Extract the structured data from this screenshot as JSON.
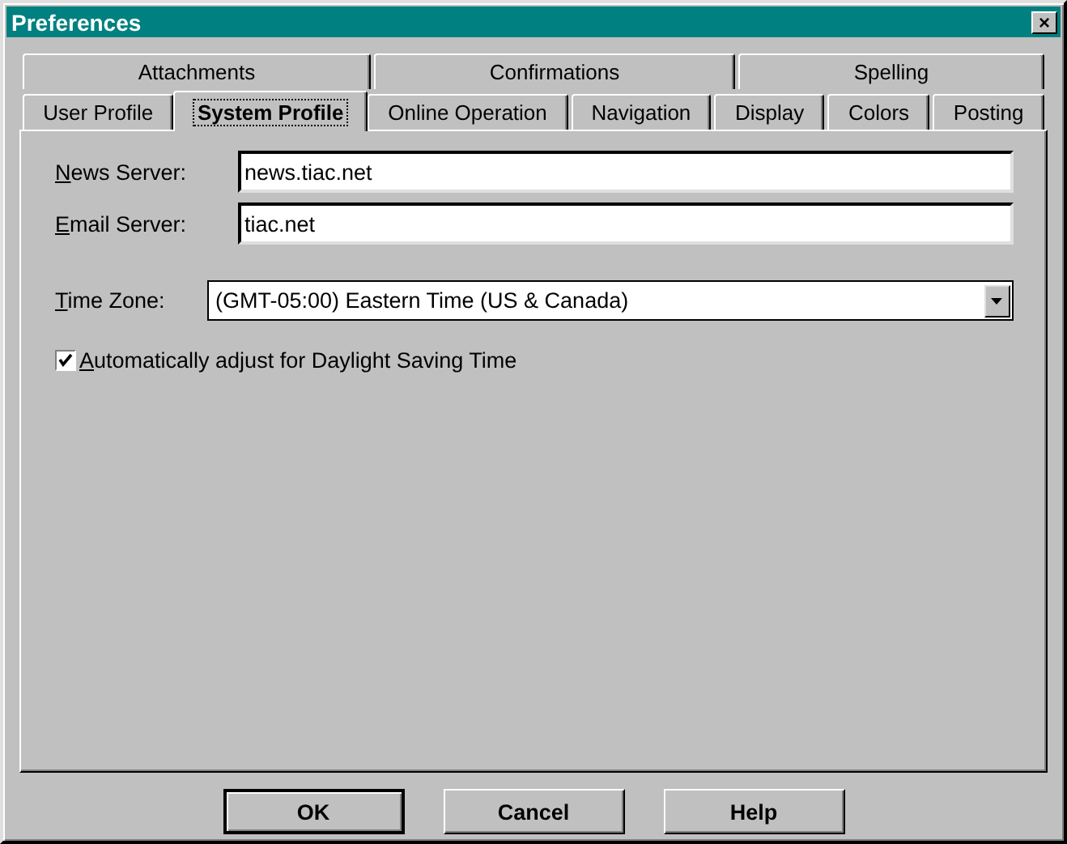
{
  "window": {
    "title": "Preferences",
    "close": "×"
  },
  "tab_rows": [
    {
      "tabs": [
        {
          "label": "Attachments",
          "selected": false
        },
        {
          "label": "Confirmations",
          "selected": false
        },
        {
          "label": "Spelling",
          "selected": false
        }
      ]
    },
    {
      "tabs": [
        {
          "label": "User Profile",
          "selected": false
        },
        {
          "label": "System Profile",
          "selected": true
        },
        {
          "label": "Online Operation",
          "selected": false
        },
        {
          "label": "Navigation",
          "selected": false
        },
        {
          "label": "Display",
          "selected": false
        },
        {
          "label": "Colors",
          "selected": false
        },
        {
          "label": "Posting",
          "selected": false
        }
      ]
    }
  ],
  "fields": [
    {
      "label": "News Server:",
      "mnemonic": true,
      "value": "news.tiac.net"
    },
    {
      "label": "Email Server:",
      "mnemonic": true,
      "value": "tiac.net"
    }
  ],
  "time_zone": {
    "label": "Time Zone:",
    "mnemonic": true,
    "value": "(GMT-05:00) Eastern Time (US & Canada)"
  },
  "daylight": {
    "label": "Automatically adjust for Daylight Saving Time",
    "mnemonic": true,
    "checked": true
  },
  "buttons": [
    {
      "label": "OK",
      "default": true
    },
    {
      "label": "Cancel",
      "default": false
    },
    {
      "label": "Help",
      "default": false
    }
  ]
}
